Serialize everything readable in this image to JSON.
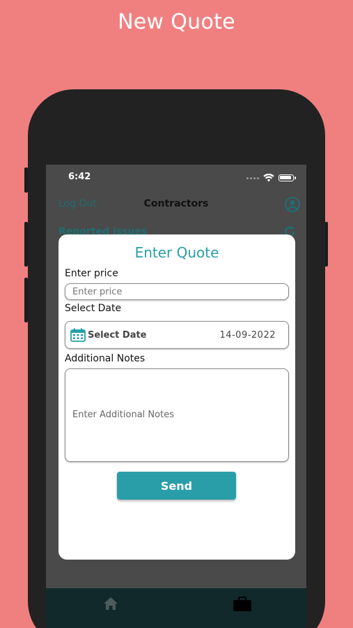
{
  "banner": {
    "title": "New Quote"
  },
  "status_bar": {
    "time": "6:42"
  },
  "header": {
    "logout_label": "Log Out",
    "title": "Contractors"
  },
  "list": {
    "section_label": "Reported issues"
  },
  "modal": {
    "title": "Enter Quote",
    "price_label": "Enter price",
    "price_placeholder": "Enter price",
    "price_value": "",
    "date_label": "Select Date",
    "date_button_label": "Select Date",
    "date_value": "14-09-2022",
    "notes_label": "Additional Notes",
    "notes_placeholder": "Enter Additional Notes",
    "send_label": "Send"
  },
  "icons": {
    "profile": "user-circle-icon",
    "refresh": "refresh-icon",
    "calendar": "calendar-icon",
    "home": "home-icon",
    "briefcase": "briefcase-icon"
  },
  "colors": {
    "background": "#f08080",
    "accent": "#2a9ea8",
    "header_link": "#1f6e72",
    "nav_bar": "#11292b"
  }
}
